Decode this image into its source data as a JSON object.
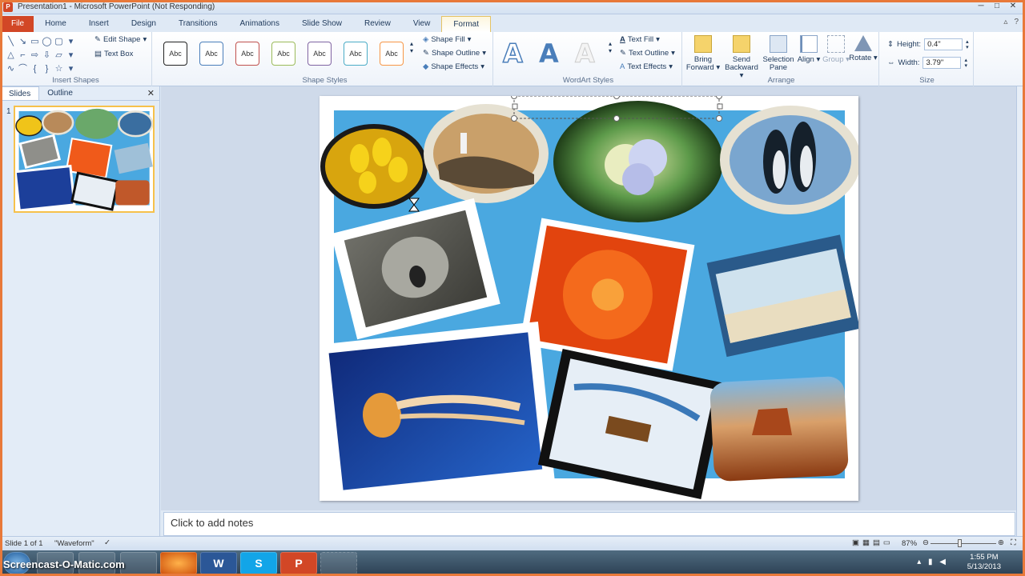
{
  "window": {
    "title": "Presentation1 - Microsoft PowerPoint (Not Responding)"
  },
  "tabs": [
    "File",
    "Home",
    "Insert",
    "Design",
    "Transitions",
    "Animations",
    "Slide Show",
    "Review",
    "View",
    "Format"
  ],
  "active_tab": "Format",
  "ribbon": {
    "insert_shapes": {
      "label": "Insert Shapes",
      "edit_shape": "Edit Shape",
      "text_box": "Text Box"
    },
    "shape_styles": {
      "label": "Shape Styles",
      "sample": "Abc",
      "shape_fill": "Shape Fill",
      "shape_outline": "Shape Outline",
      "shape_effects": "Shape Effects"
    },
    "wordart_styles": {
      "label": "WordArt Styles",
      "letter": "A",
      "text_fill": "Text Fill",
      "text_outline": "Text Outline",
      "text_effects": "Text Effects"
    },
    "arrange": {
      "label": "Arrange",
      "bring_forward": "Bring Forward",
      "send_backward": "Send Backward",
      "selection_pane": "Selection Pane",
      "align": "Align",
      "group": "Group",
      "rotate": "Rotate"
    },
    "size": {
      "label": "Size",
      "height_label": "Height:",
      "height_value": "0.4\"",
      "width_label": "Width:",
      "width_value": "3.79\""
    }
  },
  "left_panel": {
    "tab_slides": "Slides",
    "tab_outline": "Outline",
    "slide_number": "1"
  },
  "notes": {
    "placeholder": "Click to add notes"
  },
  "statusbar": {
    "slide_info": "Slide 1 of 1",
    "theme": "\"Waveform\"",
    "zoom": "87%"
  },
  "taskbar": {
    "watermark": "Screencast-O-Matic.com",
    "time": "1:55 PM",
    "date": "5/13/2013"
  },
  "colors": {
    "file_tab": "#d24726",
    "slide_background": "#4aa8e0",
    "ribbon_accent": "#e5c365"
  }
}
